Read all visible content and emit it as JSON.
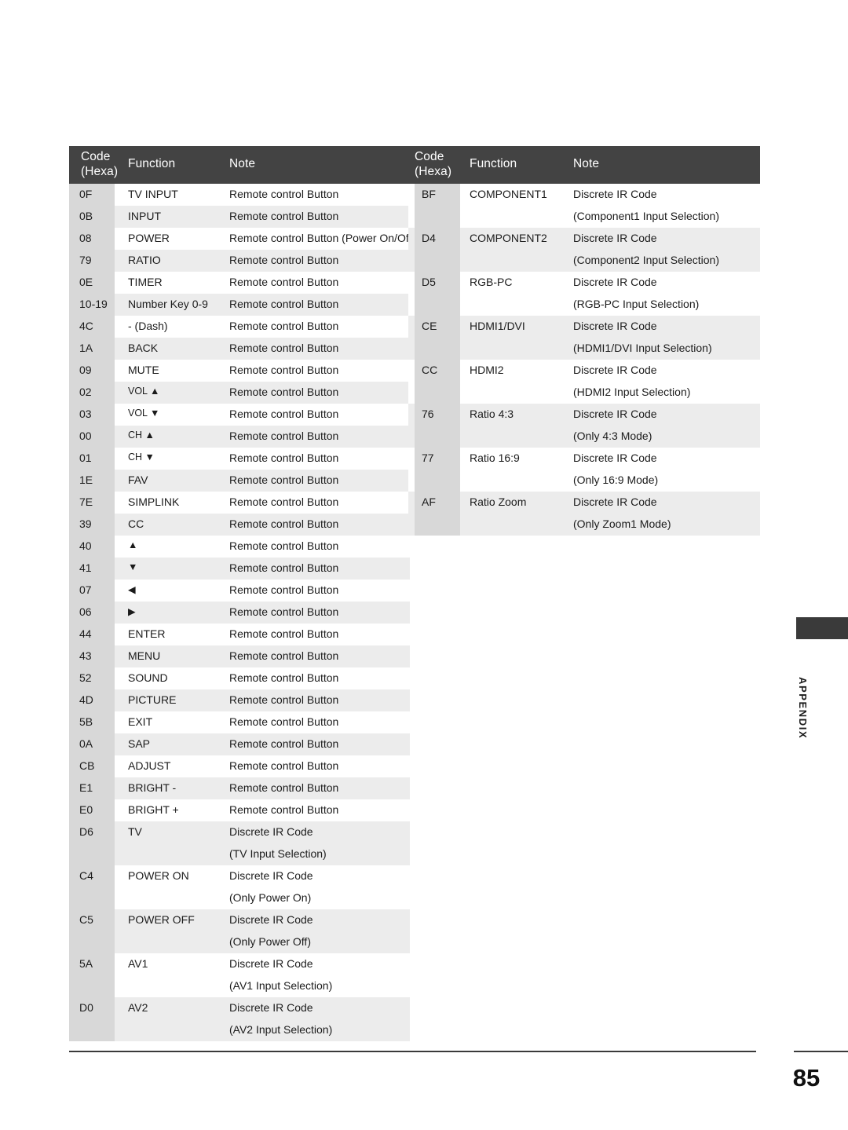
{
  "page": {
    "number": "85",
    "side_tab_label": "APPENDIX"
  },
  "headers": {
    "code": "Code",
    "code_sub": "(Hexa)",
    "function": "Function",
    "note": "Note"
  },
  "notes_text": {
    "remote": "Remote control Button",
    "remote_power": "Remote control Button (Power On/Off)",
    "discrete": "Discrete IR Code"
  },
  "left_table": {
    "rows": [
      {
        "code": "0F",
        "function": "TV INPUT",
        "note": "Remote control Button",
        "note2": "",
        "lines": 1
      },
      {
        "code": "0B",
        "function": "INPUT",
        "note": "Remote control Button",
        "note2": "",
        "lines": 1
      },
      {
        "code": "08",
        "function": "POWER",
        "note": "Remote control Button (Power On/Off)",
        "note2": "",
        "lines": 1
      },
      {
        "code": "79",
        "function": "RATIO",
        "note": "Remote control Button",
        "note2": "",
        "lines": 1
      },
      {
        "code": "0E",
        "function": "TIMER",
        "note": "Remote control Button",
        "note2": "",
        "lines": 1
      },
      {
        "code": "10-19",
        "function": "Number Key 0-9",
        "note": "Remote control Button",
        "note2": "",
        "lines": 1
      },
      {
        "code": "4C",
        "function": "- (Dash)",
        "note": "Remote control Button",
        "note2": "",
        "lines": 1
      },
      {
        "code": "1A",
        "function": "BACK",
        "note": "Remote control Button",
        "note2": "",
        "lines": 1
      },
      {
        "code": "09",
        "function": "MUTE",
        "note": "Remote control Button",
        "note2": "",
        "lines": 1
      },
      {
        "code": "02",
        "function": "VOL ▲",
        "note": "Remote control Button",
        "note2": "",
        "lines": 1
      },
      {
        "code": "03",
        "function": "VOL ▼",
        "note": "Remote control Button",
        "note2": "",
        "lines": 1
      },
      {
        "code": "00",
        "function": "CH ▲",
        "note": "Remote control Button",
        "note2": "",
        "lines": 1
      },
      {
        "code": "01",
        "function": "CH ▼",
        "note": "Remote control Button",
        "note2": "",
        "lines": 1
      },
      {
        "code": "1E",
        "function": "FAV",
        "note": "Remote control Button",
        "note2": "",
        "lines": 1
      },
      {
        "code": "7E",
        "function": "SIMPLINK",
        "note": "Remote control Button",
        "note2": "",
        "lines": 1
      },
      {
        "code": "39",
        "function": "CC",
        "note": "Remote control Button",
        "note2": "",
        "lines": 1
      },
      {
        "code": "40",
        "function": "▲",
        "note": "Remote control Button",
        "note2": "",
        "lines": 1
      },
      {
        "code": "41",
        "function": "▼",
        "note": "Remote control Button",
        "note2": "",
        "lines": 1
      },
      {
        "code": "07",
        "function": "◀",
        "note": "Remote control Button",
        "note2": "",
        "lines": 1
      },
      {
        "code": "06",
        "function": "▶",
        "note": "Remote control Button",
        "note2": "",
        "lines": 1
      },
      {
        "code": "44",
        "function": "ENTER",
        "note": "Remote control Button",
        "note2": "",
        "lines": 1
      },
      {
        "code": "43",
        "function": "MENU",
        "note": "Remote control Button",
        "note2": "",
        "lines": 1
      },
      {
        "code": "52",
        "function": "SOUND",
        "note": "Remote control Button",
        "note2": "",
        "lines": 1
      },
      {
        "code": "4D",
        "function": "PICTURE",
        "note": "Remote control Button",
        "note2": "",
        "lines": 1
      },
      {
        "code": "5B",
        "function": "EXIT",
        "note": "Remote control Button",
        "note2": "",
        "lines": 1
      },
      {
        "code": "0A",
        "function": "SAP",
        "note": "Remote control Button",
        "note2": "",
        "lines": 1
      },
      {
        "code": "CB",
        "function": "ADJUST",
        "note": "Remote control Button",
        "note2": "",
        "lines": 1
      },
      {
        "code": "E1",
        "function": "BRIGHT -",
        "note": "Remote control Button",
        "note2": "",
        "lines": 1
      },
      {
        "code": "E0",
        "function": "BRIGHT +",
        "note": "Remote control Button",
        "note2": "",
        "lines": 1
      },
      {
        "code": "D6",
        "function": "TV",
        "note": "Discrete IR Code",
        "note2": "(TV Input Selection)",
        "lines": 2
      },
      {
        "code": "C4",
        "function": "POWER ON",
        "note": "Discrete IR Code",
        "note2": "(Only Power On)",
        "lines": 2
      },
      {
        "code": "C5",
        "function": "POWER OFF",
        "note": "Discrete IR Code",
        "note2": "(Only Power Off)",
        "lines": 2
      },
      {
        "code": "5A",
        "function": "AV1",
        "note": "Discrete IR Code",
        "note2": "(AV1 Input Selection)",
        "lines": 2
      },
      {
        "code": "D0",
        "function": "AV2",
        "note": "Discrete IR Code",
        "note2": "(AV2 Input Selection)",
        "lines": 2
      }
    ]
  },
  "right_table": {
    "rows": [
      {
        "code": "BF",
        "function": "COMPONENT1",
        "note": "Discrete IR Code",
        "note2": "(Component1 Input Selection)",
        "lines": 2
      },
      {
        "code": "D4",
        "function": "COMPONENT2",
        "note": "Discrete IR Code",
        "note2": "(Component2 Input Selection)",
        "lines": 2
      },
      {
        "code": "D5",
        "function": "RGB-PC",
        "note": "Discrete IR Code",
        "note2": "(RGB-PC Input Selection)",
        "lines": 2
      },
      {
        "code": "CE",
        "function": "HDMI1/DVI",
        "note": "Discrete IR Code",
        "note2": "(HDMI1/DVI Input Selection)",
        "lines": 2
      },
      {
        "code": "CC",
        "function": "HDMI2",
        "note": "Discrete IR Code",
        "note2": "(HDMI2 Input Selection)",
        "lines": 2
      },
      {
        "code": "76",
        "function": "Ratio 4:3",
        "note": "Discrete IR Code",
        "note2": "(Only 4:3 Mode)",
        "lines": 2
      },
      {
        "code": "77",
        "function": "Ratio 16:9",
        "note": "Discrete IR Code",
        "note2": "(Only 16:9 Mode)",
        "lines": 2
      },
      {
        "code": "AF",
        "function": "Ratio Zoom",
        "note": "Discrete IR Code",
        "note2": "(Only Zoom1 Mode)",
        "lines": 2
      }
    ]
  },
  "colors": {
    "header_bg": "#434343",
    "code_cell_bg": "#d8d8d8",
    "row_alt_bg": "#ececec",
    "row_bg": "#ffffff",
    "rule": "#3a3a3a"
  }
}
